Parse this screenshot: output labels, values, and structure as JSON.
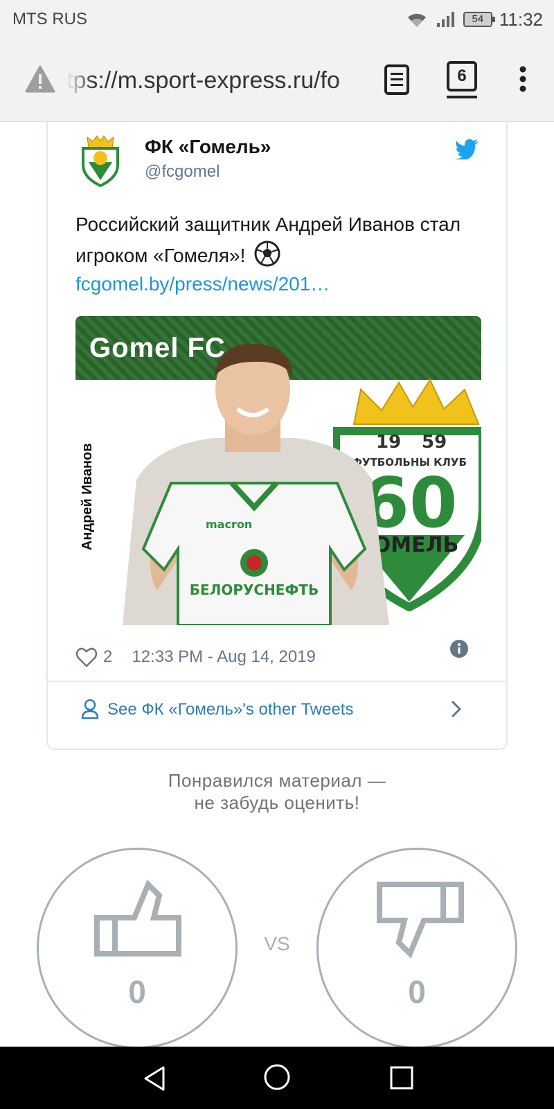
{
  "status_bar": {
    "carrier": "MTS RUS",
    "battery": "54",
    "time": "11:32"
  },
  "browser": {
    "url": "tps://m.sport-express.ru/fo",
    "tab_count": "6"
  },
  "tweet": {
    "author_name": "ФК «Гомель»",
    "author_handle": "@fcgomel",
    "text": "Российский защитник Андрей Иванов стал игроком «Гомеля»!",
    "link": "fcgomel.by/press/news/201…",
    "image": {
      "brand": "Gomel FC",
      "player_name": "Андрей Иванов",
      "crest_year_left": "19",
      "crest_year_right": "59",
      "crest_club": "ФУТБОЛЬНЫ КЛУБ",
      "crest_number": "60",
      "crest_city": "ГОМЕЛЬ",
      "shirt_sponsor": "БЕЛОРУСНЕФТЬ",
      "shirt_brand": "macron"
    },
    "likes": "2",
    "timestamp": "12:33 PM - Aug 14, 2019",
    "see_other": "See ФК «Гомель»'s other Tweets"
  },
  "rating": {
    "prompt_line1": "Понравился материал —",
    "prompt_line2": "не забудь оценить!",
    "likes": "0",
    "vs": "VS",
    "dislikes": "0"
  },
  "colors": {
    "link": "#1b95e0",
    "twitter": "#1da1f2",
    "club_green": "#2b6a2c",
    "rating_gray": "#a9b0b5"
  }
}
